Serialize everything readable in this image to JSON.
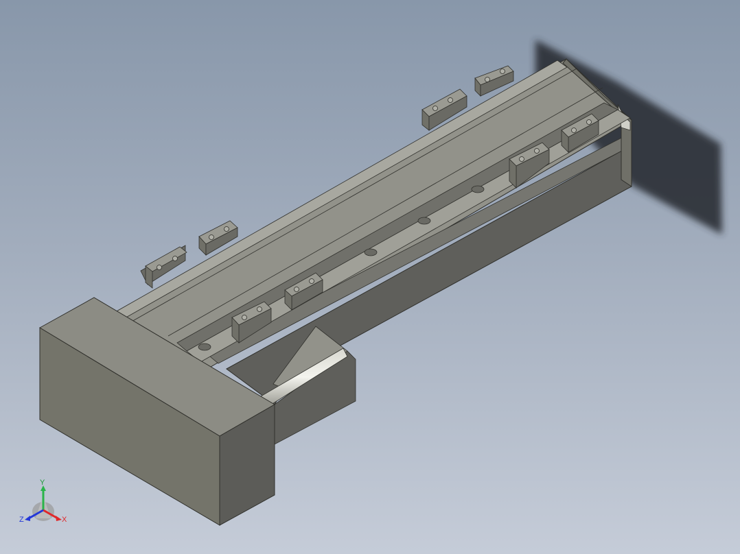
{
  "viewport": {
    "background_top": "#8897aa",
    "background_bottom": "#c5ccd8"
  },
  "model": {
    "body_color": "#84847a",
    "dark_face_color": "#5e5e5a",
    "light_face_color": "#9a9a92",
    "shadow_color": "#2c2f35"
  },
  "triad": {
    "x_label": "X",
    "y_label": "Y",
    "z_label": "Z",
    "x_color": "#e0282a",
    "y_color": "#2ab44a",
    "z_color": "#2438d8"
  }
}
